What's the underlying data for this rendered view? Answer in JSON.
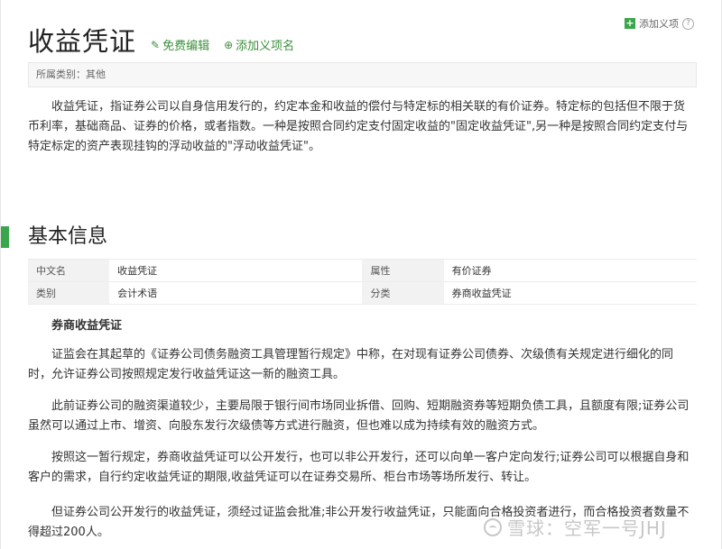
{
  "header": {
    "title": "收益凭证",
    "edit_label": "免费编辑",
    "add_item_label": "添加义项名",
    "top_add_label": "添加义项",
    "help_glyph": "?"
  },
  "category": {
    "text": "所属类别：其他"
  },
  "intro": {
    "text": "收益凭证，指证券公司以自身信用发行的，约定本金和收益的偿付与特定标的相关联的有价证券。特定标的包括但不限于货币利率，基础商品、证券的价格，或者指数。一种是按照合同约定支付固定收益的\"固定收益凭证\",另一种是按照合同约定支付与特定标定的资产表现挂钩的浮动收益的\"浮动收益凭证\"。"
  },
  "basic_info": {
    "title": "基本信息",
    "rows": [
      {
        "k1": "中文名",
        "v1": "收益凭证",
        "k2": "属性",
        "v2": "有价证券"
      },
      {
        "k1": "类别",
        "v1": "会计术语",
        "k2": "分类",
        "v2": "券商收益凭证"
      }
    ]
  },
  "section": {
    "subtitle": "券商收益凭证",
    "paragraphs": [
      "证监会在其起草的《证券公司债务融资工具管理暂行规定》中称，在对现有证券公司债券、次级债有关规定进行细化的同时，允许证券公司按照规定发行收益凭证这一新的融资工具。",
      "此前证券公司的融资渠道较少，主要局限于银行间市场同业拆借、回购、短期融资券等短期负债工具，且额度有限;证券公司虽然可以通过上市、增资、向股东发行次级债等方式进行融资，但也难以成为持续有效的融资方式。",
      "按照这一暂行规定，券商收益凭证可以公开发行，也可以非公开发行，还可以向单一客户定向发行;证券公司可以根据自身和客户的需求，自行约定收益凭证的期限,收益凭证可以在证券交易所、柜台市场等场所发行、转让。",
      "但证券公司公开发行的收益凭证，须经过证监会批准;非公开发行收益凭证，只能面向合格投资者进行，而合格投资者数量不得超过200人。"
    ]
  },
  "watermark": {
    "text": "雪球：空军一号JHJ"
  },
  "colors": {
    "accent": "#3aa64c",
    "link": "#3a8f3a"
  }
}
